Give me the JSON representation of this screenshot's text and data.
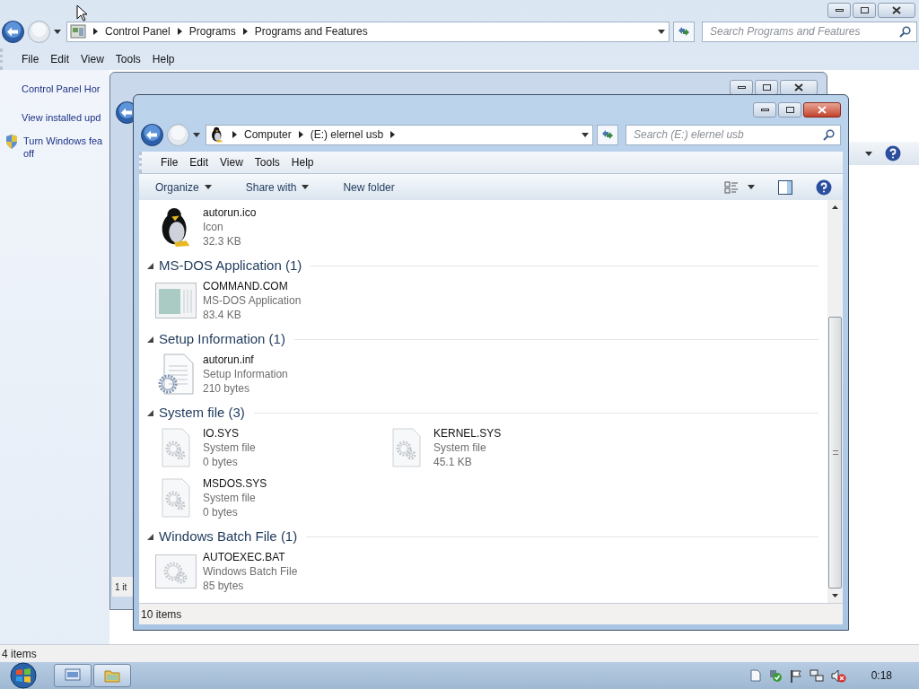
{
  "back_window": {
    "address": {
      "crumbs": [
        "Control Panel",
        "Programs",
        "Programs and Features"
      ]
    },
    "search": {
      "placeholder": "Search Programs and Features"
    },
    "menu": [
      "File",
      "Edit",
      "View",
      "Tools",
      "Help"
    ],
    "sidebar": [
      {
        "kind": "link",
        "lines": [
          "Control Panel Hor"
        ]
      },
      {
        "kind": "link",
        "lines": [
          "View installed upd"
        ]
      },
      {
        "kind": "shield-link",
        "lines": [
          "Turn Windows fea",
          "off"
        ]
      }
    ],
    "status_bar": "4 items"
  },
  "middle_window": {
    "status_bar": "1 it"
  },
  "front_window": {
    "address": {
      "crumbs": [
        "Computer",
        "(E:) elernel usb"
      ]
    },
    "search": {
      "placeholder": "Search (E:) elernel usb"
    },
    "menu": [
      "File",
      "Edit",
      "View",
      "Tools",
      "Help"
    ],
    "commands": [
      {
        "label": "Organize",
        "dropdown": true
      },
      {
        "label": "Share with",
        "dropdown": true
      },
      {
        "label": "New folder",
        "dropdown": false
      }
    ],
    "groups": [
      {
        "items": [
          {
            "kind": "penguin",
            "name": "autorun.ico",
            "type": "Icon",
            "size": "32.3 KB"
          }
        ]
      },
      {
        "header": "MS-DOS Application (1)",
        "expanded": true,
        "items": [
          {
            "kind": "app",
            "name": "COMMAND.COM",
            "type": "MS-DOS Application",
            "size": "83.4 KB"
          }
        ]
      },
      {
        "header": "Setup Information (1)",
        "expanded": true,
        "items": [
          {
            "kind": "setup",
            "name": "autorun.inf",
            "type": "Setup Information",
            "size": "210 bytes"
          }
        ]
      },
      {
        "header": "System file (3)",
        "expanded": true,
        "items": [
          {
            "kind": "system",
            "name": "IO.SYS",
            "type": "System file",
            "size": "0 bytes"
          },
          {
            "kind": "system",
            "name": "KERNEL.SYS",
            "type": "System file",
            "size": "45.1 KB"
          },
          {
            "kind": "system",
            "name": "MSDOS.SYS",
            "type": "System file",
            "size": "0 bytes"
          }
        ]
      },
      {
        "header": "Windows Batch File (1)",
        "expanded": true,
        "items": [
          {
            "kind": "batch",
            "name": "AUTOEXEC.BAT",
            "type": "Windows Batch File",
            "size": "85 bytes"
          }
        ]
      }
    ],
    "status_bar": "10 items"
  },
  "taskbar": {
    "clock": "0:18"
  }
}
